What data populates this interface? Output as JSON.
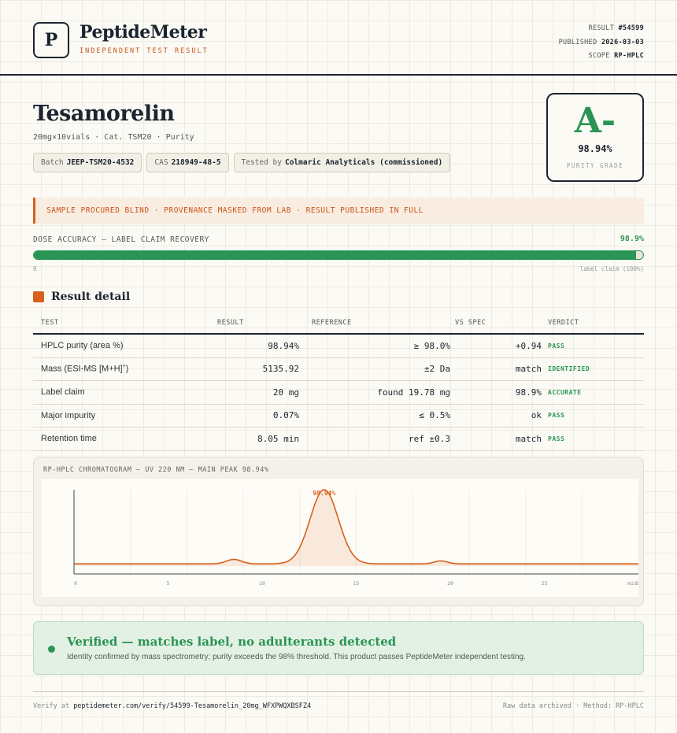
{
  "brand": {
    "logo_letter": "P",
    "name": "PeptideMeter",
    "subtitle": "INDEPENDENT TEST RESULT"
  },
  "meta": {
    "result_label": "RESULT",
    "result_value": "#54599",
    "published_label": "PUBLISHED",
    "published_value": "2026-03-03",
    "scope_label": "SCOPE",
    "scope_value": "RP-HPLC"
  },
  "product": {
    "title": "Tesamorelin",
    "subtitle": "20mg×10vials · Cat. TSM20 · Purity",
    "pills": {
      "batch_label": "Batch",
      "batch_value": "JEEP-TSM20-4532",
      "cas_label": "CAS",
      "cas_value": "218949-48-5",
      "tested_label": "Tested by",
      "tested_value": "Colmaric Analyticals (commissioned)"
    }
  },
  "grade": {
    "letter": "A-",
    "percent": "98.94%",
    "label": "PURITY GRADE",
    "color": "#2a9454"
  },
  "notice": "SAMPLE PROCURED BLIND · PROVENANCE MASKED FROM LAB · RESULT PUBLISHED IN FULL",
  "dose": {
    "label": "DOSE ACCURACY — LABEL CLAIM RECOVERY",
    "value_text": "98.9%",
    "fraction": 0.989,
    "zero_label": "0",
    "claim_label": "label claim (100%)"
  },
  "results": {
    "section_title": "Result detail",
    "headers": {
      "test": "TEST",
      "result": "RESULT",
      "reference": "REFERENCE",
      "vs_spec": "VS SPEC",
      "verdict": "VERDICT"
    },
    "rows": [
      {
        "test": "HPLC purity (area %)",
        "result": "98.94%",
        "reference": "≥ 98.0%",
        "vs_spec": "+0.94",
        "verdict": "PASS"
      },
      {
        "test": "Mass (ESI-MS [M+H]",
        "test_sup": "+",
        "test_end": ")",
        "result": "5135.92",
        "reference": "±2 Da",
        "vs_spec": "match",
        "verdict": "IDENTIFIED"
      },
      {
        "test": "Label claim",
        "result": "20 mg",
        "reference": "found 19.78 mg",
        "vs_spec": "98.9%",
        "verdict": "ACCURATE"
      },
      {
        "test": "Major impurity",
        "result": "0.07%",
        "reference": "≤ 0.5%",
        "vs_spec": "ok",
        "verdict": "PASS"
      },
      {
        "test": "Retention time",
        "result": "8.05 min",
        "reference": "ref ±0.3",
        "vs_spec": "match",
        "verdict": "PASS"
      }
    ]
  },
  "chart_data": {
    "type": "line",
    "title": "RP-HPLC CHROMATOGRAM — UV 220 NM — MAIN PEAK 98.94%",
    "x_ticks": [
      "0",
      "5",
      "10",
      "15",
      "20",
      "25",
      "30"
    ],
    "x_unit_label": "min",
    "xlim": [
      0,
      30
    ],
    "peak_label": "98.94%",
    "peaks": [
      {
        "x": 8.5,
        "height": 0.06,
        "width": 0.4
      },
      {
        "x": 13.3,
        "height": 1.0,
        "width": 0.75
      },
      {
        "x": 19.5,
        "height": 0.04,
        "width": 0.35
      }
    ],
    "color": "#d8601c"
  },
  "verified": {
    "title": "Verified — matches label, no adulterants detected",
    "description": "Identity confirmed by mass spectrometry; purity exceeds the 98% threshold. This product passes PeptideMeter independent testing."
  },
  "footer": {
    "verify_prefix": "Verify at",
    "verify_url": "peptidemeter.com/verify/54599-Tesamorelin_20mg_WFXPWQXBSFZ4",
    "right": "Raw data archived · Method: RP-HPLC"
  }
}
